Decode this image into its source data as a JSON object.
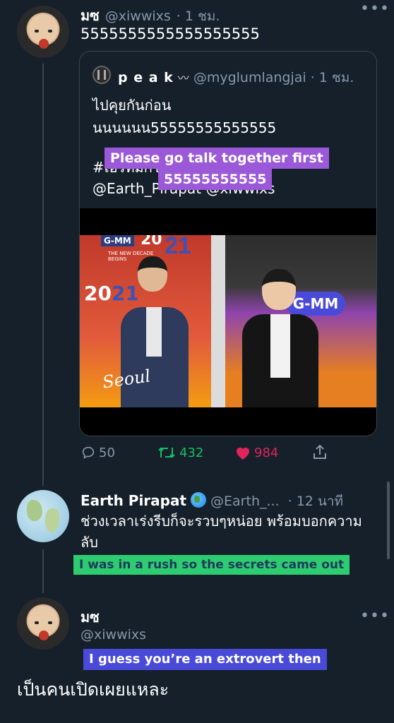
{
  "tweet1": {
    "name": "มซ",
    "handle": "@xiwwixs",
    "time": "· 1 ชม.",
    "text": "5555555555555555555"
  },
  "quote": {
    "name": "p e a k",
    "handle": "@myglumlangjai",
    "time": "· 1 ชม.",
    "line1": "ไปคุยกันก่อน",
    "line2": "นนนนนน55555555555555",
    "line3": "#เอิร์ทมิกซ์",
    "line4": "@Earth_Pirapat @xiwwixs",
    "overlay_line1": "Please go talk together first",
    "overlay_line2": "55555555555",
    "video_text_logo1": "G-MM",
    "video_text_20": "20",
    "video_text_21": "21",
    "video_text_decade": "THE NEW DECADE BEGINS",
    "video_watermark": "Seoul"
  },
  "actions": {
    "reply_count": "50",
    "retweet_count": "432",
    "like_count": "984"
  },
  "reply1": {
    "name": "Earth Pirapat",
    "handle": "@Earth_...",
    "time": "· 12 นาที",
    "text_line1": "ช่วงเวลาเร่งรีบก็จะรวบๆหน่อย พร้อมบอกความ",
    "text_line2": "ลับ",
    "overlay": "I was in a rush so the secrets came out"
  },
  "reply2": {
    "name": "มซ",
    "handle": "@xiwwixs",
    "overlay": "I guess you’re an extrovert then",
    "text": "เป็นคนเปิดเผยแหละ"
  },
  "colors": {
    "background": "#15202b",
    "muted": "#8899a6",
    "retweet_green": "#17bf63",
    "like_red": "#e0245e",
    "overlay_purple": "#9b59d9",
    "overlay_green": "#2ecc71",
    "overlay_blue": "#4a4ad9"
  }
}
